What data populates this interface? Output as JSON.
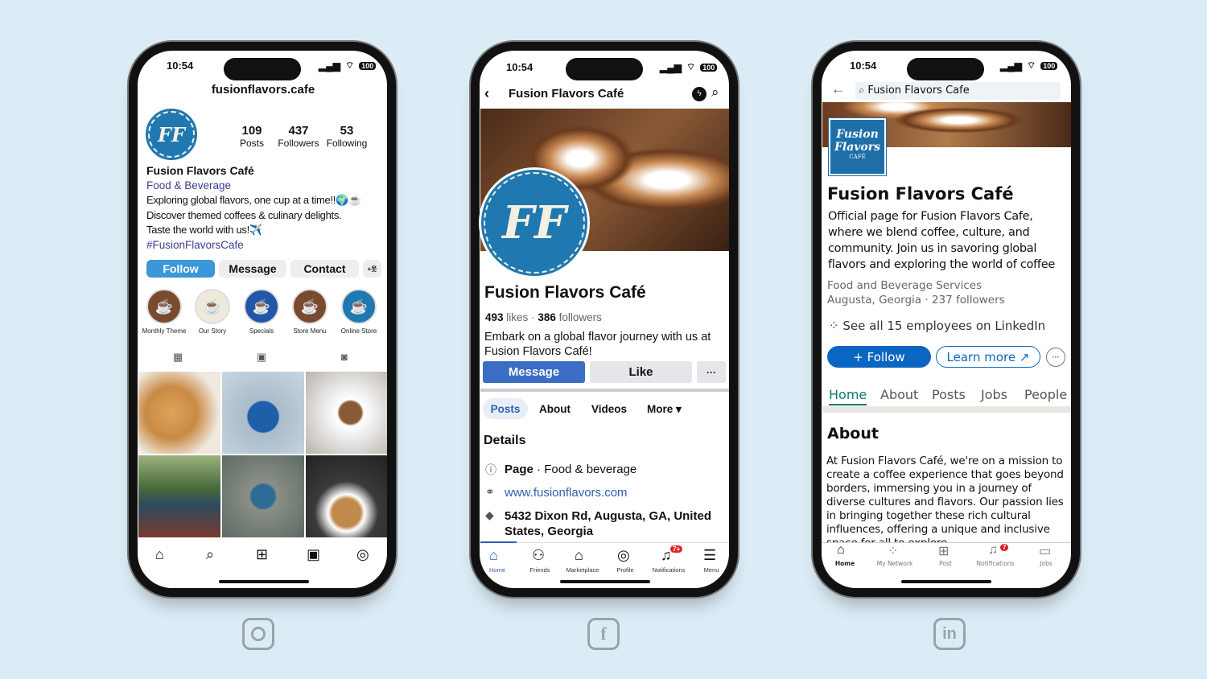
{
  "status_time": "10:54",
  "battery": "100",
  "instagram": {
    "username": "fusionflavors.cafe",
    "avatar_text": "FF",
    "stats": [
      {
        "value": "109",
        "label": "Posts"
      },
      {
        "value": "437",
        "label": "Followers"
      },
      {
        "value": "53",
        "label": "Following"
      }
    ],
    "name": "Fusion Flavors Café",
    "category": "Food & Beverage",
    "bio": [
      "Exploring global flavors, one cup at a time!!🌍☕",
      "Discover themed coffees & culinary delights.",
      "Taste the world with us!✈️"
    ],
    "hashtag": "#FusionFlavorsCafe",
    "buttons": {
      "follow": "Follow",
      "message": "Message",
      "contact": "Contact",
      "add": "+웃"
    },
    "highlights": [
      {
        "label": "Monthly Theme",
        "color": "#7a4a2e"
      },
      {
        "label": "Our Story",
        "color": "#efe9dc"
      },
      {
        "label": "Specials",
        "color": "#2456a8"
      },
      {
        "label": "Store Menu",
        "color": "#7a4a2e"
      },
      {
        "label": "Online Store",
        "color": "#1f78b0"
      }
    ],
    "accent": "#3a97d8"
  },
  "facebook": {
    "title": "Fusion Flavors Café",
    "avatar_text": "FF",
    "name": "Fusion Flavors Café",
    "likes": "493",
    "likes_label": "likes",
    "followers": "386",
    "followers_label": "followers",
    "description": "Embark on a global flavor journey with us at Fusion Flavors Café!",
    "buttons": {
      "message": "Message",
      "like": "Like",
      "more": "···"
    },
    "tabs": [
      "Posts",
      "About",
      "Videos",
      "More ▾"
    ],
    "details_title": "Details",
    "details": {
      "page": "Page",
      "category": " · Food & beverage",
      "website": "www.fusionflavors.com",
      "address": "5432 Dixon Rd, Augusta, GA, United States, Georgia"
    },
    "nav": [
      {
        "label": "Home",
        "icon": "home-icon"
      },
      {
        "label": "Friends",
        "icon": "friends-icon"
      },
      {
        "label": "Marketplace",
        "icon": "marketplace-icon"
      },
      {
        "label": "Profile",
        "icon": "profile-icon"
      },
      {
        "label": "Notifications",
        "icon": "bell-icon",
        "badge": "7+"
      },
      {
        "label": "Menu",
        "icon": "menu-icon"
      }
    ],
    "accent": "#3b6dc4"
  },
  "linkedin": {
    "search_value": "Fusion Flavors Cafe",
    "logo": {
      "line1": "Fusion",
      "line2": "Flavors",
      "line3": "CAFÉ"
    },
    "name": "Fusion Flavors Café",
    "tagline": "Official page for Fusion Flavors Cafe, where we blend coffee, culture, and community. Join us in savoring global flavors and exploring the world of coffee",
    "industry": "Food and Beverage Services",
    "location": "Augusta, Georgia",
    "followers": "237 followers",
    "employees": "See all 15 employees on LinkedIn",
    "buttons": {
      "follow": "+ Follow",
      "learn_more": "Learn more ↗",
      "more": "···"
    },
    "tabs": [
      "Home",
      "About",
      "Posts",
      "Jobs",
      "People"
    ],
    "about_title": "About",
    "about": "At Fusion Flavors Café, we're on a mission to create a coffee experience that goes beyond borders, immersing you in a journey of diverse cultures and flavors. Our passion lies in bringing together these rich cultural influences, offering a unique and inclusive space for all to explore.",
    "nav": [
      {
        "label": "Home",
        "icon": "home-icon"
      },
      {
        "label": "My Network",
        "icon": "network-icon"
      },
      {
        "label": "Post",
        "icon": "post-icon"
      },
      {
        "label": "Notifications",
        "icon": "bell-icon",
        "badge": "7"
      },
      {
        "label": "Jobs",
        "icon": "briefcase-icon"
      }
    ],
    "accent": "#0a66c2"
  },
  "brand_icons": [
    "instagram-icon",
    "facebook-icon",
    "linkedin-icon"
  ]
}
